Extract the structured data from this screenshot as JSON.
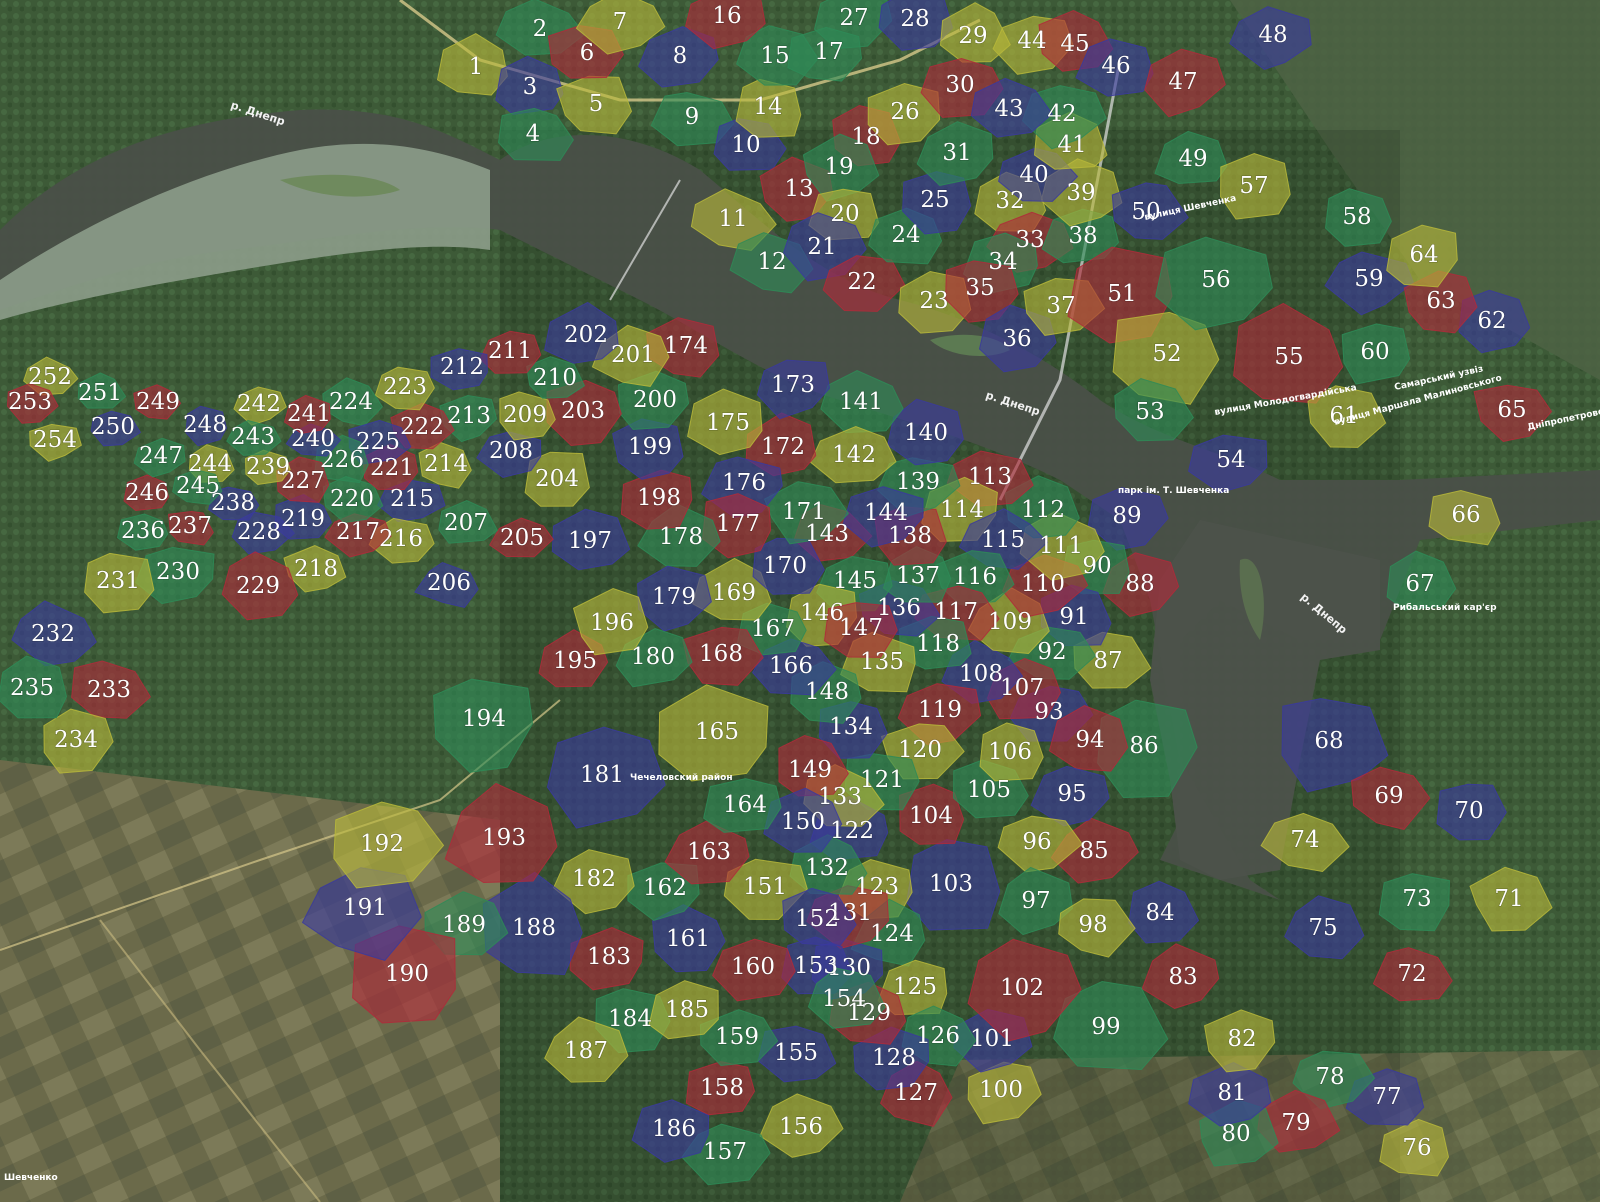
{
  "map": {
    "colors": {
      "green": "#2e8b57",
      "blue": "#3a3a9e",
      "red": "#b02a3a",
      "yellow": "#b8b83a"
    },
    "districts": [
      {
        "id": "1",
        "color": "yellow"
      },
      {
        "id": "2",
        "color": "green"
      },
      {
        "id": "3",
        "color": "blue"
      },
      {
        "id": "4",
        "color": "green"
      },
      {
        "id": "5",
        "color": "yellow"
      },
      {
        "id": "6",
        "color": "red"
      },
      {
        "id": "7",
        "color": "yellow"
      },
      {
        "id": "8",
        "color": "blue"
      },
      {
        "id": "9",
        "color": "green"
      },
      {
        "id": "10",
        "color": "blue"
      },
      {
        "id": "11",
        "color": "yellow"
      },
      {
        "id": "12",
        "color": "green"
      },
      {
        "id": "13",
        "color": "red"
      },
      {
        "id": "14",
        "color": "yellow"
      },
      {
        "id": "15",
        "color": "green"
      },
      {
        "id": "16",
        "color": "red"
      },
      {
        "id": "17",
        "color": "green"
      },
      {
        "id": "18",
        "color": "red"
      },
      {
        "id": "19",
        "color": "green"
      },
      {
        "id": "20",
        "color": "yellow"
      },
      {
        "id": "21",
        "color": "blue"
      },
      {
        "id": "22",
        "color": "red"
      },
      {
        "id": "23",
        "color": "yellow"
      },
      {
        "id": "24",
        "color": "green"
      },
      {
        "id": "25",
        "color": "blue"
      },
      {
        "id": "26",
        "color": "yellow"
      },
      {
        "id": "27",
        "color": "green"
      },
      {
        "id": "28",
        "color": "blue"
      },
      {
        "id": "29",
        "color": "yellow"
      },
      {
        "id": "30",
        "color": "red"
      },
      {
        "id": "31",
        "color": "green"
      },
      {
        "id": "32",
        "color": "yellow"
      },
      {
        "id": "33",
        "color": "red"
      },
      {
        "id": "34",
        "color": "green"
      },
      {
        "id": "35",
        "color": "red"
      },
      {
        "id": "36",
        "color": "blue"
      },
      {
        "id": "37",
        "color": "yellow"
      },
      {
        "id": "38",
        "color": "green"
      },
      {
        "id": "39",
        "color": "yellow"
      },
      {
        "id": "40",
        "color": "blue"
      },
      {
        "id": "41",
        "color": "yellow"
      },
      {
        "id": "42",
        "color": "green"
      },
      {
        "id": "43",
        "color": "blue"
      },
      {
        "id": "44",
        "color": "yellow"
      },
      {
        "id": "45",
        "color": "red"
      },
      {
        "id": "46",
        "color": "blue"
      },
      {
        "id": "47",
        "color": "red"
      },
      {
        "id": "48",
        "color": "blue"
      },
      {
        "id": "49",
        "color": "green"
      },
      {
        "id": "50",
        "color": "blue"
      },
      {
        "id": "51",
        "color": "red"
      },
      {
        "id": "52",
        "color": "yellow"
      },
      {
        "id": "53",
        "color": "green"
      },
      {
        "id": "54",
        "color": "blue"
      },
      {
        "id": "55",
        "color": "red"
      },
      {
        "id": "56",
        "color": "green"
      },
      {
        "id": "57",
        "color": "yellow"
      },
      {
        "id": "58",
        "color": "green"
      },
      {
        "id": "59",
        "color": "blue"
      },
      {
        "id": "60",
        "color": "green"
      },
      {
        "id": "61",
        "color": "yellow"
      },
      {
        "id": "62",
        "color": "blue"
      },
      {
        "id": "63",
        "color": "red"
      },
      {
        "id": "64",
        "color": "yellow"
      },
      {
        "id": "65",
        "color": "red"
      },
      {
        "id": "66",
        "color": "yellow"
      },
      {
        "id": "67",
        "color": "green"
      },
      {
        "id": "68",
        "color": "blue"
      },
      {
        "id": "69",
        "color": "red"
      },
      {
        "id": "70",
        "color": "blue"
      },
      {
        "id": "71",
        "color": "yellow"
      },
      {
        "id": "72",
        "color": "red"
      },
      {
        "id": "73",
        "color": "green"
      },
      {
        "id": "74",
        "color": "yellow"
      },
      {
        "id": "75",
        "color": "blue"
      },
      {
        "id": "76",
        "color": "yellow"
      },
      {
        "id": "77",
        "color": "blue"
      },
      {
        "id": "78",
        "color": "green"
      },
      {
        "id": "79",
        "color": "red"
      },
      {
        "id": "80",
        "color": "green"
      },
      {
        "id": "81",
        "color": "blue"
      },
      {
        "id": "82",
        "color": "yellow"
      },
      {
        "id": "83",
        "color": "red"
      },
      {
        "id": "84",
        "color": "blue"
      },
      {
        "id": "85",
        "color": "red"
      },
      {
        "id": "86",
        "color": "green"
      },
      {
        "id": "87",
        "color": "yellow"
      },
      {
        "id": "88",
        "color": "red"
      },
      {
        "id": "89",
        "color": "blue"
      },
      {
        "id": "90",
        "color": "green"
      },
      {
        "id": "91",
        "color": "blue"
      },
      {
        "id": "92",
        "color": "green"
      },
      {
        "id": "93",
        "color": "blue"
      },
      {
        "id": "94",
        "color": "red"
      },
      {
        "id": "95",
        "color": "blue"
      },
      {
        "id": "96",
        "color": "yellow"
      },
      {
        "id": "97",
        "color": "green"
      },
      {
        "id": "98",
        "color": "yellow"
      },
      {
        "id": "99",
        "color": "green"
      },
      {
        "id": "100",
        "color": "yellow"
      },
      {
        "id": "101",
        "color": "blue"
      },
      {
        "id": "102",
        "color": "red"
      },
      {
        "id": "103",
        "color": "blue"
      },
      {
        "id": "104",
        "color": "red"
      },
      {
        "id": "105",
        "color": "green"
      },
      {
        "id": "106",
        "color": "yellow"
      },
      {
        "id": "107",
        "color": "red"
      },
      {
        "id": "108",
        "color": "blue"
      },
      {
        "id": "109",
        "color": "yellow"
      },
      {
        "id": "110",
        "color": "red"
      },
      {
        "id": "111",
        "color": "yellow"
      },
      {
        "id": "112",
        "color": "green"
      },
      {
        "id": "113",
        "color": "red"
      },
      {
        "id": "114",
        "color": "yellow"
      },
      {
        "id": "115",
        "color": "blue"
      },
      {
        "id": "116",
        "color": "green"
      },
      {
        "id": "117",
        "color": "red"
      },
      {
        "id": "118",
        "color": "green"
      },
      {
        "id": "119",
        "color": "red"
      },
      {
        "id": "120",
        "color": "yellow"
      },
      {
        "id": "121",
        "color": "green"
      },
      {
        "id": "122",
        "color": "blue"
      },
      {
        "id": "123",
        "color": "yellow"
      },
      {
        "id": "124",
        "color": "green"
      },
      {
        "id": "125",
        "color": "yellow"
      },
      {
        "id": "126",
        "color": "green"
      },
      {
        "id": "127",
        "color": "red"
      },
      {
        "id": "128",
        "color": "blue"
      },
      {
        "id": "129",
        "color": "red"
      },
      {
        "id": "130",
        "color": "blue"
      },
      {
        "id": "131",
        "color": "red"
      },
      {
        "id": "132",
        "color": "green"
      },
      {
        "id": "133",
        "color": "yellow"
      },
      {
        "id": "134",
        "color": "blue"
      },
      {
        "id": "135",
        "color": "yellow"
      },
      {
        "id": "136",
        "color": "blue"
      },
      {
        "id": "137",
        "color": "green"
      },
      {
        "id": "138",
        "color": "red"
      },
      {
        "id": "139",
        "color": "green"
      },
      {
        "id": "140",
        "color": "blue"
      },
      {
        "id": "141",
        "color": "green"
      },
      {
        "id": "142",
        "color": "yellow"
      },
      {
        "id": "143",
        "color": "red"
      },
      {
        "id": "144",
        "color": "blue"
      },
      {
        "id": "145",
        "color": "green"
      },
      {
        "id": "146",
        "color": "yellow"
      },
      {
        "id": "147",
        "color": "red"
      },
      {
        "id": "148",
        "color": "green"
      },
      {
        "id": "149",
        "color": "red"
      },
      {
        "id": "150",
        "color": "blue"
      },
      {
        "id": "151",
        "color": "yellow"
      },
      {
        "id": "152",
        "color": "blue"
      },
      {
        "id": "153",
        "color": "blue"
      },
      {
        "id": "154",
        "color": "green"
      },
      {
        "id": "155",
        "color": "blue"
      },
      {
        "id": "156",
        "color": "yellow"
      },
      {
        "id": "157",
        "color": "green"
      },
      {
        "id": "158",
        "color": "red"
      },
      {
        "id": "159",
        "color": "green"
      },
      {
        "id": "160",
        "color": "red"
      },
      {
        "id": "161",
        "color": "blue"
      },
      {
        "id": "162",
        "color": "green"
      },
      {
        "id": "163",
        "color": "red"
      },
      {
        "id": "164",
        "color": "green"
      },
      {
        "id": "165",
        "color": "yellow"
      },
      {
        "id": "166",
        "color": "blue"
      },
      {
        "id": "167",
        "color": "green"
      },
      {
        "id": "168",
        "color": "red"
      },
      {
        "id": "169",
        "color": "yellow"
      },
      {
        "id": "170",
        "color": "blue"
      },
      {
        "id": "171",
        "color": "green"
      },
      {
        "id": "172",
        "color": "red"
      },
      {
        "id": "173",
        "color": "blue"
      },
      {
        "id": "174",
        "color": "red"
      },
      {
        "id": "175",
        "color": "yellow"
      },
      {
        "id": "176",
        "color": "blue"
      },
      {
        "id": "177",
        "color": "red"
      },
      {
        "id": "178",
        "color": "green"
      },
      {
        "id": "179",
        "color": "blue"
      },
      {
        "id": "180",
        "color": "green"
      },
      {
        "id": "181",
        "color": "blue"
      },
      {
        "id": "182",
        "color": "yellow"
      },
      {
        "id": "183",
        "color": "red"
      },
      {
        "id": "184",
        "color": "green"
      },
      {
        "id": "185",
        "color": "yellow"
      },
      {
        "id": "186",
        "color": "blue"
      },
      {
        "id": "187",
        "color": "yellow"
      },
      {
        "id": "188",
        "color": "blue"
      },
      {
        "id": "189",
        "color": "green"
      },
      {
        "id": "190",
        "color": "red"
      },
      {
        "id": "191",
        "color": "blue"
      },
      {
        "id": "192",
        "color": "yellow"
      },
      {
        "id": "193",
        "color": "red"
      },
      {
        "id": "194",
        "color": "green"
      },
      {
        "id": "195",
        "color": "red"
      },
      {
        "id": "196",
        "color": "yellow"
      },
      {
        "id": "197",
        "color": "blue"
      },
      {
        "id": "198",
        "color": "red"
      },
      {
        "id": "199",
        "color": "blue"
      },
      {
        "id": "200",
        "color": "green"
      },
      {
        "id": "201",
        "color": "yellow"
      },
      {
        "id": "202",
        "color": "blue"
      },
      {
        "id": "203",
        "color": "red"
      },
      {
        "id": "204",
        "color": "yellow"
      },
      {
        "id": "205",
        "color": "red"
      },
      {
        "id": "206",
        "color": "blue"
      },
      {
        "id": "207",
        "color": "green"
      },
      {
        "id": "208",
        "color": "blue"
      },
      {
        "id": "209",
        "color": "yellow"
      },
      {
        "id": "210",
        "color": "green"
      },
      {
        "id": "211",
        "color": "red"
      },
      {
        "id": "212",
        "color": "blue"
      },
      {
        "id": "213",
        "color": "green"
      },
      {
        "id": "214",
        "color": "yellow"
      },
      {
        "id": "215",
        "color": "blue"
      },
      {
        "id": "216",
        "color": "yellow"
      },
      {
        "id": "217",
        "color": "red"
      },
      {
        "id": "218",
        "color": "yellow"
      },
      {
        "id": "219",
        "color": "blue"
      },
      {
        "id": "220",
        "color": "green"
      },
      {
        "id": "221",
        "color": "red"
      },
      {
        "id": "222",
        "color": "red"
      },
      {
        "id": "223",
        "color": "yellow"
      },
      {
        "id": "224",
        "color": "green"
      },
      {
        "id": "225",
        "color": "blue"
      },
      {
        "id": "226",
        "color": "green"
      },
      {
        "id": "227",
        "color": "red"
      },
      {
        "id": "228",
        "color": "blue"
      },
      {
        "id": "229",
        "color": "red"
      },
      {
        "id": "230",
        "color": "green"
      },
      {
        "id": "231",
        "color": "yellow"
      },
      {
        "id": "232",
        "color": "blue"
      },
      {
        "id": "233",
        "color": "red"
      },
      {
        "id": "234",
        "color": "yellow"
      },
      {
        "id": "235",
        "color": "green"
      },
      {
        "id": "236",
        "color": "green"
      },
      {
        "id": "237",
        "color": "red"
      },
      {
        "id": "238",
        "color": "blue"
      },
      {
        "id": "239",
        "color": "yellow"
      },
      {
        "id": "240",
        "color": "blue"
      },
      {
        "id": "241",
        "color": "red"
      },
      {
        "id": "242",
        "color": "yellow"
      },
      {
        "id": "243",
        "color": "green"
      },
      {
        "id": "244",
        "color": "yellow"
      },
      {
        "id": "245",
        "color": "green"
      },
      {
        "id": "246",
        "color": "red"
      },
      {
        "id": "247",
        "color": "green"
      },
      {
        "id": "248",
        "color": "blue"
      },
      {
        "id": "249",
        "color": "red"
      },
      {
        "id": "250",
        "color": "blue"
      },
      {
        "id": "251",
        "color": "green"
      },
      {
        "id": "252",
        "color": "yellow"
      },
      {
        "id": "253",
        "color": "red"
      },
      {
        "id": "254",
        "color": "yellow"
      }
    ],
    "street_labels": [
      {
        "text": "р. Днепр",
        "key": "river-dnepr-west"
      },
      {
        "text": "р. Днепр",
        "key": "river-dnepr-center"
      },
      {
        "text": "р. Днепр",
        "key": "river-dnepr-east"
      },
      {
        "text": "вулиця Молодогвардійська",
        "key": "molodogvardiyska"
      },
      {
        "text": "Самарський узвіз",
        "key": "samarskyi"
      },
      {
        "text": "вулиця Маршала Малиновського",
        "key": "malynovskoho"
      },
      {
        "text": "вулиця Шевченка",
        "key": "shevchenka"
      },
      {
        "text": "Рибальський кар'єр",
        "key": "rybalskyi"
      },
      {
        "text": "парк ім. Т. Шевченка",
        "key": "park"
      },
      {
        "text": "Шевченко",
        "key": "shevchenko-village"
      },
      {
        "text": "Дніпропетровська область",
        "key": "oblast"
      },
      {
        "text": "Чечеловский район",
        "key": "chechelovsky"
      }
    ]
  }
}
